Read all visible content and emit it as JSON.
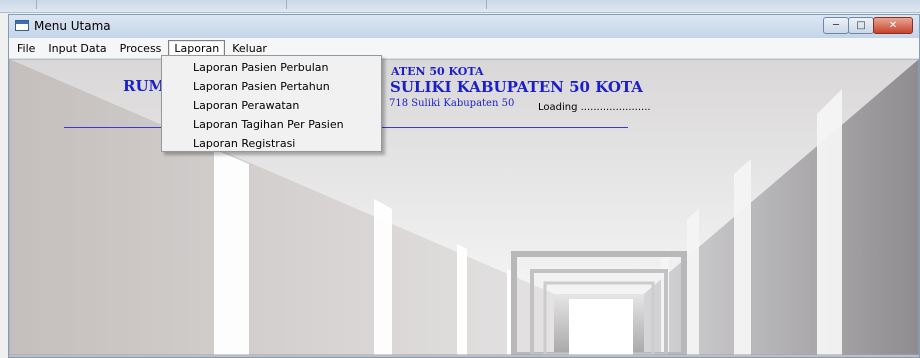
{
  "window": {
    "title": "Menu Utama",
    "controls": {
      "minimize_icon": "minimize-icon",
      "maximize_icon": "maximize-icon",
      "close_icon": "close-icon"
    }
  },
  "menubar": {
    "items": [
      {
        "label": "File"
      },
      {
        "label": "Input Data"
      },
      {
        "label": "Process"
      },
      {
        "label": "Laporan",
        "active": true
      },
      {
        "label": "Keluar"
      }
    ]
  },
  "dropdown": {
    "items": [
      {
        "label": "Laporan Pasien Perbulan"
      },
      {
        "label": "Laporan Pasien Pertahun"
      },
      {
        "label": "Laporan Perawatan"
      },
      {
        "label": "Laporan Tagihan Per Pasien"
      },
      {
        "label": "Laporan Registrasi"
      }
    ]
  },
  "header": {
    "line1": "ATEN 50 KOTA",
    "line2a": "RUM",
    "line2b": "SULIKI KABUPATEN 50 KOTA",
    "line3": "718 Suliki Kabupaten 50",
    "loading": "Loading ......................"
  },
  "colors": {
    "header_text": "#1b1fc8",
    "titlebar": "#c5d5e8",
    "close_button": "#c6442b"
  }
}
